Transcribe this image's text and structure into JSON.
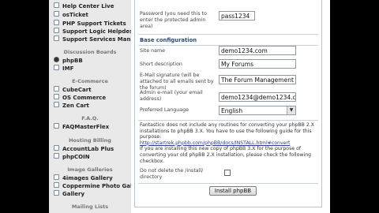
{
  "sidebar": {
    "items_top": [
      {
        "label": "Help Center Live"
      },
      {
        "label": "osTicket"
      },
      {
        "label": "PHP Support Tickets"
      },
      {
        "label": "Support Logic Helpdesk"
      },
      {
        "label": "Support Services Manager"
      }
    ],
    "discussion_boards": {
      "heading": "Discussion Boards",
      "items": [
        {
          "label": "phpBB",
          "selected": true
        },
        {
          "label": "IMF"
        }
      ]
    },
    "ecommerce": {
      "heading": "E-Commerce",
      "items": [
        {
          "label": "CubeCart"
        },
        {
          "label": "OS Commerce"
        },
        {
          "label": "Zen Cart"
        }
      ]
    },
    "faq": {
      "heading": "F.A.Q.",
      "items": [
        {
          "label": "FAQMasterFlex"
        }
      ]
    },
    "hosting_billing": {
      "heading": "Hosting Billing",
      "items": [
        {
          "label": "AccountLab Plus"
        },
        {
          "label": "phpCOIN"
        }
      ]
    },
    "image_galleries": {
      "heading": "Image Galleries",
      "items": [
        {
          "label": "4images Gallery"
        },
        {
          "label": "Coppermine Photo Gallery"
        },
        {
          "label": "Gallery"
        }
      ]
    },
    "mailing_lists": {
      "heading": "Mailing Lists"
    }
  },
  "form": {
    "password_label": "Password (you need this to enter the protected admin area)",
    "password_value": "pass1234",
    "base_config_heading": "Base configuration",
    "site_name_label": "Site name",
    "site_name_value": "demo1234.com",
    "short_desc_label": "Short description",
    "short_desc_value": "My Forums",
    "email_sig_label": "E-Mail signature (will be attached to all emails sent by the forum)",
    "email_sig_value": "The Forum Management",
    "admin_email_label": "Admin e-mail (your email address)",
    "admin_email_value": "demo1234@demo1234.co",
    "language_label": "Preferred Language",
    "language_value": "English",
    "notice_text": "Fantastico does not include any routines for converting your phpBB 2.X installations to phpBB 3.X. You have to use the following guide for this purpose:",
    "notice_link": "http://startrek.phpbb.com/phpBB/docs/INSTALL.html#convert",
    "notice_text2": "If you are installing this new copy of phpBB 3.X for the purpose of converting your old phpBB 2.X installation, please check the following checkbox.",
    "no_delete_label": "Do not delete the /install/ directory",
    "install_button": "Install phpBB"
  },
  "colors": {
    "section_heading": "#2b4a79",
    "sidebar_bg": "#e9e9e9",
    "link": "#2b3d8f"
  }
}
